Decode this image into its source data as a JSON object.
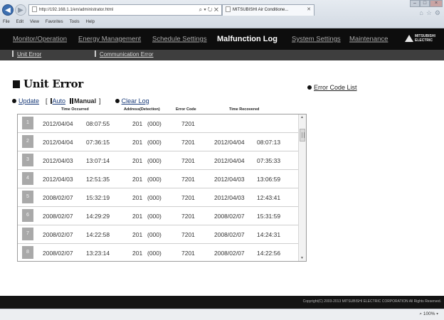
{
  "browser": {
    "address": "http://192.168.1.1/en/administrator.html",
    "address_tools": "⌕ ▾ ↻ ✕",
    "tab_title": "MITSUBISHI Air Conditione...",
    "tab_close": "✕",
    "menu": [
      "File",
      "Edit",
      "View",
      "Favorites",
      "Tools",
      "Help"
    ],
    "zoom": "⌕ 100%  ▾"
  },
  "topnav": {
    "items": [
      {
        "label": "Monitor/Operation"
      },
      {
        "label": "Energy Management"
      },
      {
        "label": "Schedule Settings"
      },
      {
        "label": "Malfunction Log"
      },
      {
        "label": "System Settings"
      },
      {
        "label": "Maintenance"
      }
    ],
    "logo_line1": "MITSUBISHI",
    "logo_line2": "ELECTRIC"
  },
  "subnav": {
    "items": [
      {
        "label": "Unit Error"
      },
      {
        "label": "Communication Error"
      }
    ]
  },
  "page": {
    "title": "Unit Error",
    "title_ghost": "Unit Error",
    "error_code_list": "Error Code List",
    "update": "Update",
    "bracket_open": "[",
    "auto": "Auto",
    "manual": "Manual",
    "bracket_close": "]",
    "clear_log": "Clear Log"
  },
  "table": {
    "headers": {
      "time_occurred": "Time Occurred",
      "address": "Address(Detection)",
      "error_code": "Error Code",
      "time_recovered": "Time Recovered"
    },
    "rows": [
      {
        "no": "1",
        "occ_date": "2012/04/04",
        "occ_time": "08:07:55",
        "addr": "201",
        "det": "(000)",
        "code": "7201",
        "rec_date": "",
        "rec_time": ""
      },
      {
        "no": "2",
        "occ_date": "2012/04/04",
        "occ_time": "07:36:15",
        "addr": "201",
        "det": "(000)",
        "code": "7201",
        "rec_date": "2012/04/04",
        "rec_time": "08:07:13"
      },
      {
        "no": "3",
        "occ_date": "2012/04/03",
        "occ_time": "13:07:14",
        "addr": "201",
        "det": "(000)",
        "code": "7201",
        "rec_date": "2012/04/04",
        "rec_time": "07:35:33"
      },
      {
        "no": "4",
        "occ_date": "2012/04/03",
        "occ_time": "12:51:35",
        "addr": "201",
        "det": "(000)",
        "code": "7201",
        "rec_date": "2012/04/03",
        "rec_time": "13:06:59"
      },
      {
        "no": "5",
        "occ_date": "2008/02/07",
        "occ_time": "15:32:19",
        "addr": "201",
        "det": "(000)",
        "code": "7201",
        "rec_date": "2012/04/03",
        "rec_time": "12:43:41"
      },
      {
        "no": "6",
        "occ_date": "2008/02/07",
        "occ_time": "14:29:29",
        "addr": "201",
        "det": "(000)",
        "code": "7201",
        "rec_date": "2008/02/07",
        "rec_time": "15:31:59"
      },
      {
        "no": "7",
        "occ_date": "2008/02/07",
        "occ_time": "14:22:58",
        "addr": "201",
        "det": "(000)",
        "code": "7201",
        "rec_date": "2008/02/07",
        "rec_time": "14:24:31"
      },
      {
        "no": "8",
        "occ_date": "2008/02/07",
        "occ_time": "13:23:14",
        "addr": "201",
        "det": "(000)",
        "code": "7201",
        "rec_date": "2008/02/07",
        "rec_time": "14:22:56"
      }
    ]
  },
  "footer": {
    "copyright": "Copyright(C) 2003-2013 MITSUBISHI ELECTRIC CORPORATION All Rights Reserved."
  }
}
